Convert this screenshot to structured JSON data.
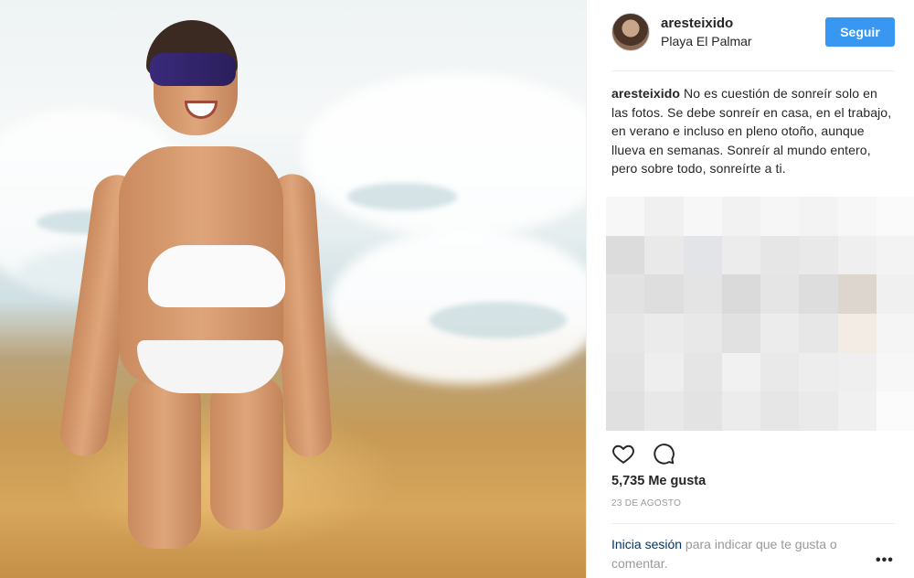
{
  "post": {
    "username": "aresteixido",
    "location": "Playa El Palmar",
    "follow_label": "Seguir",
    "caption_author": "aresteixido",
    "caption_text": " No es cuestión de sonreír solo en las fotos. Se debe sonreír en casa, en el trabajo, en verano e incluso en pleno otoño, aunque llueva en semanas. Sonreír al mundo entero, pero sobre todo, sonreírte a ti.",
    "likes": "5,735 Me gusta",
    "date": "23 DE AGOSTO",
    "login_link": "Inicia sesión",
    "login_rest": " para indicar que te gusta o comentar.",
    "more": "•••"
  },
  "icons": {
    "like": "heart-icon",
    "comment": "comment-icon",
    "more": "more-options-icon"
  },
  "colors": {
    "follow_button": "#3897f0",
    "link": "#003569",
    "muted": "#999999"
  }
}
